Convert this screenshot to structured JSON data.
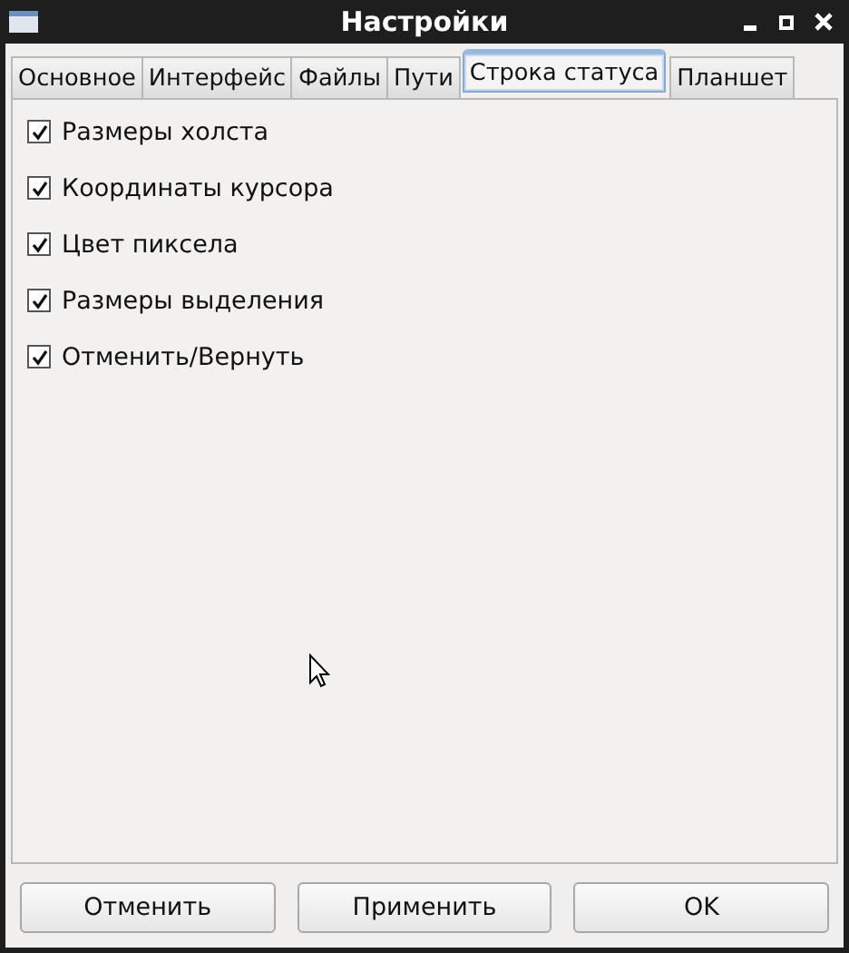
{
  "window": {
    "title": "Настройки"
  },
  "tabs": [
    {
      "label": "Основное",
      "selected": false
    },
    {
      "label": "Интерфейс",
      "selected": false
    },
    {
      "label": "Файлы",
      "selected": false
    },
    {
      "label": "Пути",
      "selected": false
    },
    {
      "label": "Строка статуса",
      "selected": true
    },
    {
      "label": "Планшет",
      "selected": false
    }
  ],
  "options": [
    {
      "label": "Размеры холста",
      "checked": true
    },
    {
      "label": "Координаты курсора",
      "checked": true
    },
    {
      "label": "Цвет пиксела",
      "checked": true
    },
    {
      "label": "Размеры выделения",
      "checked": true
    },
    {
      "label": "Отменить/Вернуть",
      "checked": true
    }
  ],
  "buttons": [
    "Отменить",
    "Применить",
    "OK"
  ]
}
